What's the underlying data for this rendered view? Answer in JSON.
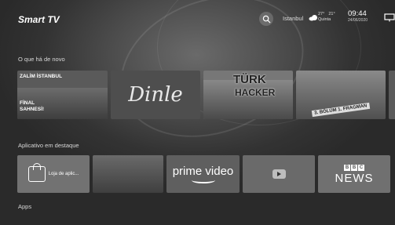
{
  "header": {
    "brand": "Smart TV",
    "city": "Istanbul",
    "temp_now": "27°",
    "temp_other": "21°",
    "day": "Quinta",
    "time": "09:44",
    "date": "24/06/2020"
  },
  "sections": {
    "news_title": "O que há de novo",
    "featured_title": "Aplicativo em destaque",
    "apps_title": "Apps"
  },
  "news": {
    "card1_top": "ZALİM İSTANBUL",
    "card1_bottom": "FİNAL SAHNESİ!",
    "card2": "Dinle",
    "card3_line1": "TÜRK",
    "card3_line2": "HACKER",
    "card4": "3. BÖLÜM 1. FRAGMAN"
  },
  "apps": {
    "store": "Loja de aplic...",
    "prime": "prime video",
    "bbc_letters": [
      "B",
      "B",
      "C"
    ],
    "bbc_news": "NEWS"
  }
}
